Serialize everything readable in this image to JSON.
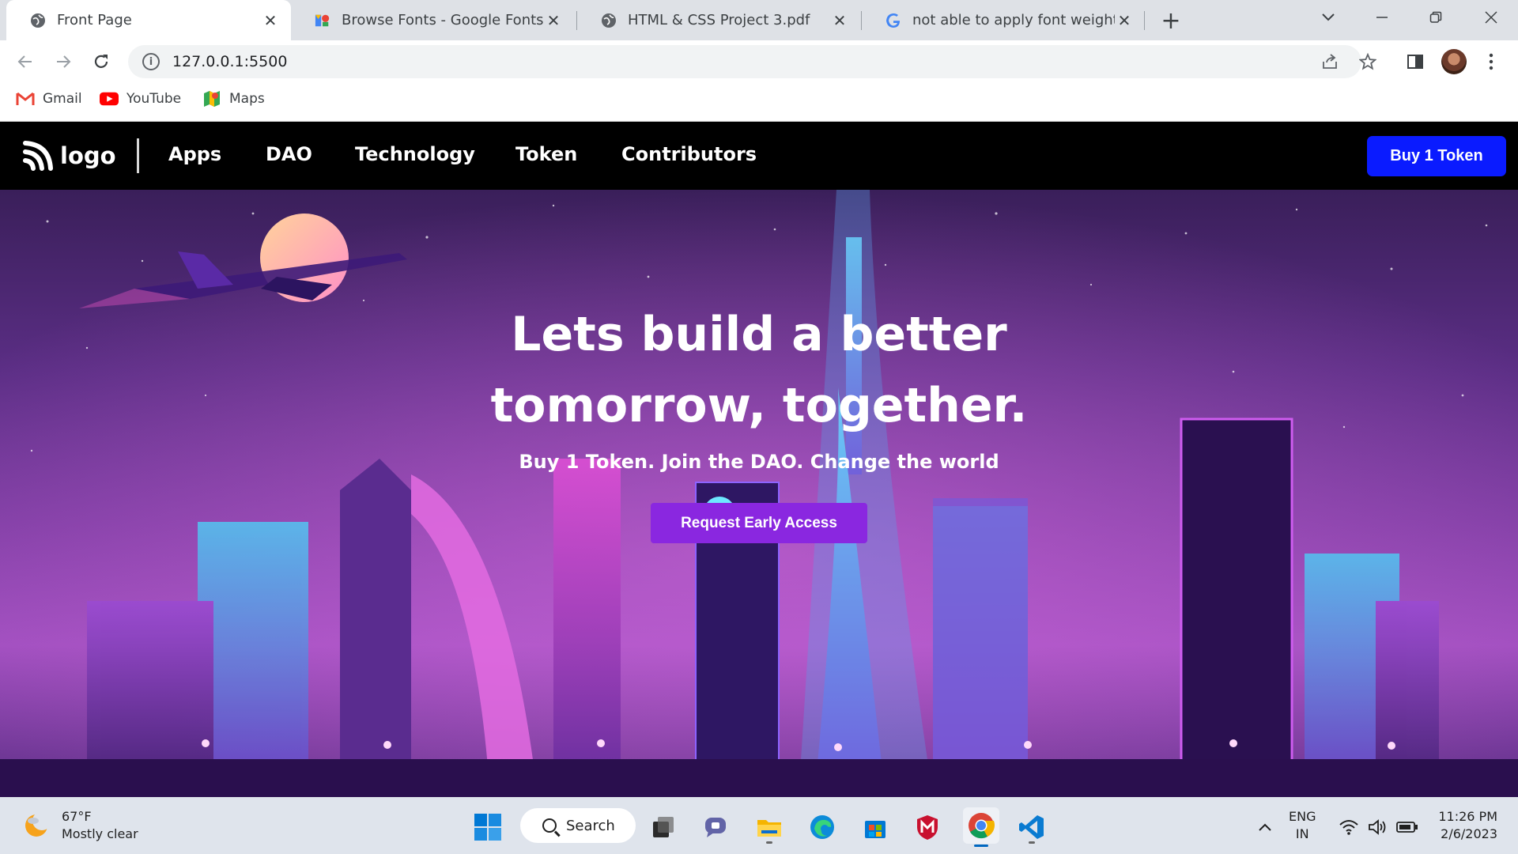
{
  "browser": {
    "tabs": [
      {
        "title": "Front Page",
        "icon": "globe-icon",
        "active": true
      },
      {
        "title": "Browse Fonts - Google Fonts",
        "icon": "google-fonts-icon",
        "active": false
      },
      {
        "title": "HTML & CSS Project 3.pdf",
        "icon": "globe-icon",
        "active": false
      },
      {
        "title": "not able to apply font weight in c",
        "icon": "google-icon",
        "active": false
      }
    ],
    "url": "127.0.0.1:5500",
    "bookmarks": [
      {
        "label": "Gmail",
        "icon": "gmail-icon"
      },
      {
        "label": "YouTube",
        "icon": "youtube-icon"
      },
      {
        "label": "Maps",
        "icon": "maps-icon"
      }
    ]
  },
  "page": {
    "logo_text": "logo",
    "nav": [
      "Apps",
      "DAO",
      "Technology",
      "Token",
      "Contributors"
    ],
    "buy_button": "Buy 1 Token",
    "hero": {
      "title_line1": "Lets build a better",
      "title_line2": "tomorrow, together.",
      "subtitle": "Buy 1 Token. Join the DAO. Change the world",
      "cta": "Request Early Access"
    },
    "colors": {
      "navbar_bg": "#000000",
      "buy_button_bg": "#0a1bff",
      "cta_bg": "#8a27e0"
    }
  },
  "taskbar": {
    "weather_temp": "67°F",
    "weather_desc": "Mostly clear",
    "search_label": "Search",
    "language_line1": "ENG",
    "language_line2": "IN",
    "time": "11:26 PM",
    "date": "2/6/2023"
  }
}
